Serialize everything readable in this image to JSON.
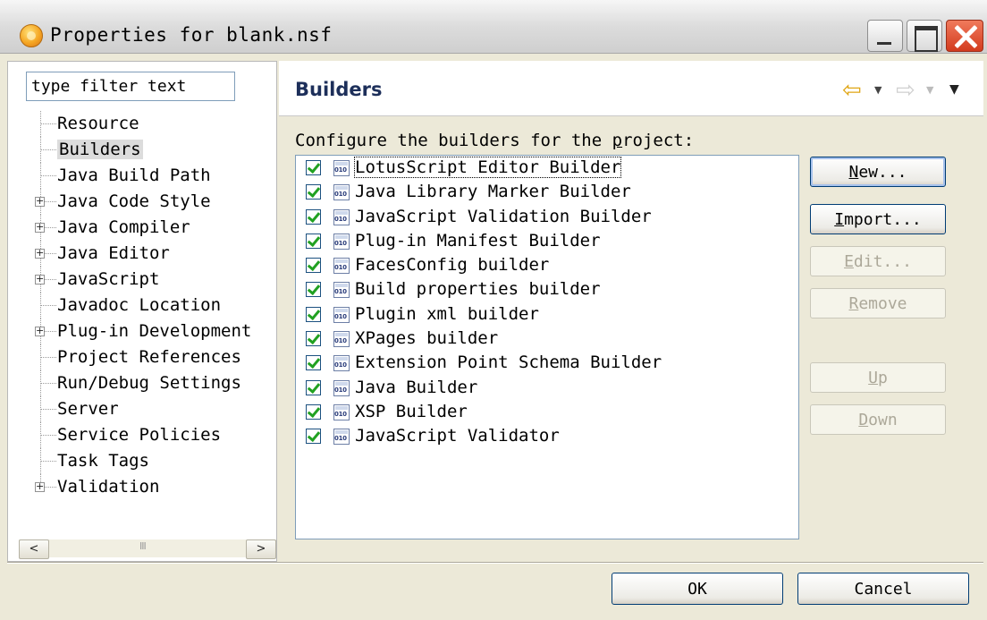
{
  "window": {
    "title": "Properties for blank.nsf",
    "colors": {
      "close": "#d33b1e",
      "title_grad": "#dcdcdc",
      "accent": "#1d2f5a"
    }
  },
  "filter": {
    "placeholder": "type filter text"
  },
  "tree": {
    "items": [
      {
        "label": "Resource",
        "expandable": false,
        "selected": false
      },
      {
        "label": "Builders",
        "expandable": false,
        "selected": true
      },
      {
        "label": "Java Build Path",
        "expandable": false,
        "selected": false
      },
      {
        "label": "Java Code Style",
        "expandable": true,
        "selected": false
      },
      {
        "label": "Java Compiler",
        "expandable": true,
        "selected": false
      },
      {
        "label": "Java Editor",
        "expandable": true,
        "selected": false
      },
      {
        "label": "JavaScript",
        "expandable": true,
        "selected": false
      },
      {
        "label": "Javadoc Location",
        "expandable": false,
        "selected": false
      },
      {
        "label": "Plug-in Development",
        "expandable": true,
        "selected": false
      },
      {
        "label": "Project References",
        "expandable": false,
        "selected": false
      },
      {
        "label": "Run/Debug Settings",
        "expandable": false,
        "selected": false
      },
      {
        "label": "Server",
        "expandable": false,
        "selected": false
      },
      {
        "label": "Service Policies",
        "expandable": false,
        "selected": false
      },
      {
        "label": "Task Tags",
        "expandable": false,
        "selected": false
      },
      {
        "label": "Validation",
        "expandable": true,
        "selected": false
      }
    ],
    "expander_glyph": "+"
  },
  "scrollbar": {
    "left_glyph": "<",
    "right_glyph": ">",
    "grip": "III"
  },
  "page": {
    "title": "Builders",
    "nav": {
      "back": "⇦",
      "dropdown": "▼",
      "forward": "⇨",
      "menu": "▼"
    },
    "config_prefix": "Configure the builders for the ",
    "config_underlined": "p",
    "config_suffix": "roject:"
  },
  "builders": [
    {
      "label": "LotusScript Editor Builder",
      "checked": true
    },
    {
      "label": "Java Library Marker Builder",
      "checked": true
    },
    {
      "label": "JavaScript Validation Builder",
      "checked": true
    },
    {
      "label": "Plug-in Manifest Builder",
      "checked": true
    },
    {
      "label": "FacesConfig builder",
      "checked": true
    },
    {
      "label": "Build properties builder",
      "checked": true
    },
    {
      "label": "Plugin xml builder",
      "checked": true
    },
    {
      "label": "XPages builder",
      "checked": true
    },
    {
      "label": "Extension Point Schema Builder",
      "checked": true
    },
    {
      "label": "Java Builder",
      "checked": true
    },
    {
      "label": "XSP Builder",
      "checked": true
    },
    {
      "label": "JavaScript Validator",
      "checked": true
    }
  ],
  "buttons": {
    "new_mn": "N",
    "new_rest": "ew...",
    "import_mn": "I",
    "import_rest": "mport...",
    "edit_mn": "E",
    "edit_rest": "dit...",
    "remove_mn": "R",
    "remove_rest": "emove",
    "up_mn": "U",
    "up_rest": "p",
    "down_mn": "D",
    "down_rest": "own",
    "ok": "OK",
    "cancel": "Cancel"
  }
}
